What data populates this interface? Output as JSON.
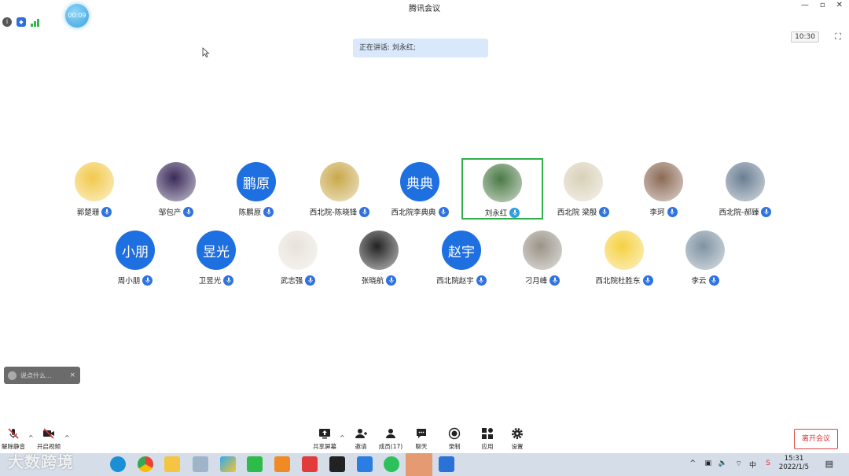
{
  "window": {
    "title": "腾讯会议",
    "controls": [
      "—",
      "▫",
      "✕"
    ]
  },
  "status": {
    "timer": "00:09",
    "clock": "10:30"
  },
  "speaking": {
    "text": "正在讲话: 刘永红;"
  },
  "participants": [
    {
      "name": "郭楚珊",
      "avatar_text": "",
      "color": "#f2c94c"
    },
    {
      "name": "邹包产",
      "avatar_text": "",
      "color": "#3a2a5a"
    },
    {
      "name": "陈鹏原",
      "avatar_text": "鹏原",
      "color": "#1e6fe0"
    },
    {
      "name": "西北院-陈晓锋",
      "avatar_text": "",
      "color": "#c8a84a"
    },
    {
      "name": "西北院李典典",
      "avatar_text": "典典",
      "color": "#1e6fe0"
    },
    {
      "name": "刘永红",
      "avatar_text": "",
      "color": "#4b7a45"
    },
    {
      "name": "西北院 梁殷",
      "avatar_text": "",
      "color": "#d8d0b8"
    },
    {
      "name": "李珂",
      "avatar_text": "",
      "color": "#8c6a55"
    },
    {
      "name": "西北院-郝臻",
      "avatar_text": "",
      "color": "#6a7f93"
    },
    {
      "name": "周小朋",
      "avatar_text": "小朋",
      "color": "#1e6fe0"
    },
    {
      "name": "卫昱光",
      "avatar_text": "昱光",
      "color": "#1e6fe0"
    },
    {
      "name": "武志强",
      "avatar_text": "",
      "color": "#e8e2da"
    },
    {
      "name": "张晓航",
      "avatar_text": "",
      "color": "#222222"
    },
    {
      "name": "西北院赵宇",
      "avatar_text": "赵宇",
      "color": "#1e6fe0"
    },
    {
      "name": "刁月峰",
      "avatar_text": "",
      "color": "#9a9388"
    },
    {
      "name": "西北院杜胜东",
      "avatar_text": "",
      "color": "#f5d142"
    },
    {
      "name": "李云",
      "avatar_text": "",
      "color": "#7f93a3"
    }
  ],
  "chat": {
    "placeholder": "说点什么...",
    "close": "×"
  },
  "toolbar": {
    "unmute": "解除静音",
    "video": "开启视频",
    "share": "共享屏幕",
    "invite": "邀请",
    "members": "成员(17)",
    "chat": "聊天",
    "record": "录制",
    "apps": "应用",
    "settings": "设置",
    "leave": "离开会议"
  },
  "taskbar": {
    "time": "15:31",
    "date": "2022/1/5",
    "ime": "中"
  },
  "watermark": "大数跨境",
  "colors": {
    "accent": "#1e6fe0",
    "active_border": "#2fae4b",
    "leave": "#d33333"
  }
}
